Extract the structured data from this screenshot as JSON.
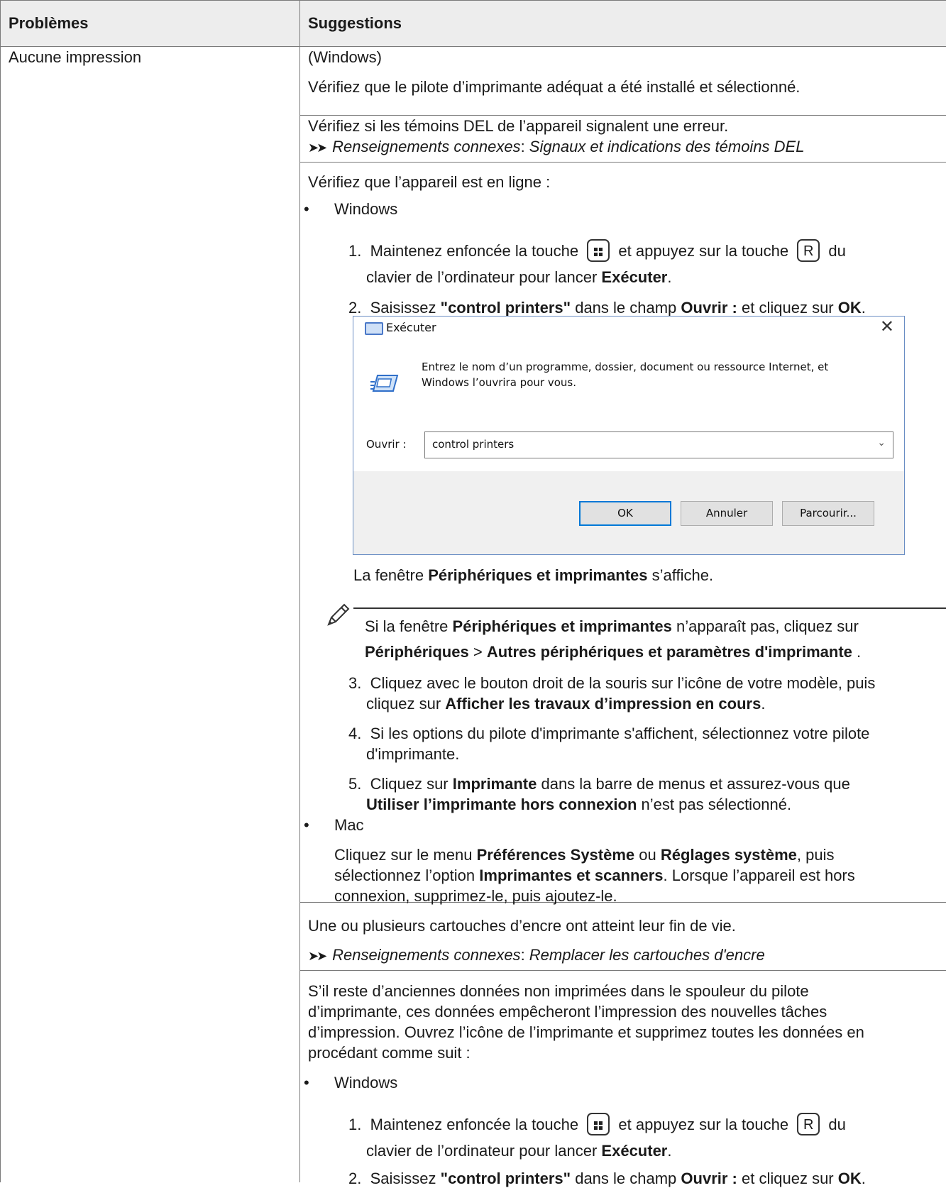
{
  "table": {
    "headers": [
      "Problèmes",
      "Suggestions"
    ],
    "problem": "Aucune impression"
  },
  "section1": {
    "windows_label": "(Windows)",
    "text": "Vérifiez que le pilote d’imprimante adéquat a été installé et sélectionné."
  },
  "section2": {
    "text": "Vérifiez si les témoins DEL de l’appareil signalent une erreur.",
    "related_label": "Renseignements connexes",
    "related_link": "Signaux et indications des témoins DEL"
  },
  "section3": {
    "intro": "Vérifiez que l’appareil est en ligne :",
    "windows": "Windows",
    "step1": {
      "num": "1.",
      "a": "Maintenez enfoncée la touche",
      "b": "et appuyez sur la touche",
      "key": "R",
      "c": "du",
      "d": "clavier de l’ordinateur pour lancer",
      "run": "Exécuter",
      "end": "."
    },
    "step2": {
      "num": "2.",
      "a": "Saisissez",
      "cmd": "\"control printers\"",
      "b": "dans le champ",
      "field": "Ouvrir :",
      "c": "et cliquez sur",
      "ok": "OK",
      "end": "."
    },
    "after_dialog": {
      "a": "La fenêtre",
      "b": "Périphériques et imprimantes",
      "c": "s’affiche."
    },
    "note": {
      "a": "Si la fenêtre",
      "b": "Périphériques et imprimantes",
      "c": "n’apparaît pas, cliquez sur",
      "d": "Périphériques",
      "e": ">",
      "f": "Autres périphériques et paramètres d'imprimante",
      "g": "."
    },
    "step3": {
      "num": "3.",
      "a": "Cliquez avec le bouton droit de la souris sur l’icône de votre modèle, puis",
      "b": "cliquez sur",
      "c": "Afficher les travaux d’impression en cours",
      "d": "."
    },
    "step4": {
      "num": "4.",
      "a": "Si les options du pilote d'imprimante s'affichent, sélectionnez votre pilote",
      "b": "d'imprimante."
    },
    "step5": {
      "num": "5.",
      "a": "Cliquez sur",
      "b": "Imprimante",
      "c": "dans la barre de menus et assurez-vous que",
      "d": "Utiliser l’imprimante hors connexion",
      "e": "n’est pas sélectionné."
    },
    "mac": "Mac",
    "mac_text": {
      "a": "Cliquez sur le menu",
      "b": "Préférences Système",
      "c": "ou",
      "d": "Réglages système",
      "e": ", puis",
      "f": "sélectionnez l’option",
      "g": "Imprimantes et scanners",
      "h": ". Lorsque l’appareil est hors",
      "i": "connexion, supprimez-le, puis ajoutez-le."
    }
  },
  "dialog": {
    "title": "Exécuter",
    "description_line1": "Entrez le nom d’un programme, dossier, document ou ressource Internet, et",
    "description_line2": "Windows l’ouvrira pour vous.",
    "open_label": "Ouvrir :",
    "open_value": "control printers",
    "ok": "OK",
    "cancel": "Annuler",
    "browse": "Parcourir..."
  },
  "section4": {
    "text": "Une ou plusieurs cartouches d’encre ont atteint leur fin de vie.",
    "related_label": "Renseignements connexes",
    "related_link": "Remplacer les cartouches d'encre"
  },
  "section5": {
    "line1": "S’il reste d’anciennes données non imprimées dans le spouleur du pilote",
    "line2": "d’imprimante, ces données empêcheront l’impression des nouvelles tâches",
    "line3": "d’impression. Ouvrez l’icône de l’imprimante et supprimez toutes les données en",
    "line4": "procédant comme suit :",
    "windows": "Windows",
    "step1": {
      "num": "1.",
      "a": "Maintenez enfoncée la touche",
      "b": "et appuyez sur la touche",
      "key": "R",
      "c": "du",
      "d": "clavier de l’ordinateur pour lancer",
      "run": "Exécuter",
      "end": "."
    },
    "step2": {
      "num": "2.",
      "a": "Saisissez",
      "cmd": "\"control printers\"",
      "b": "dans le champ",
      "field": "Ouvrir :",
      "c": "et cliquez sur",
      "ok": "OK",
      "end": "."
    }
  }
}
